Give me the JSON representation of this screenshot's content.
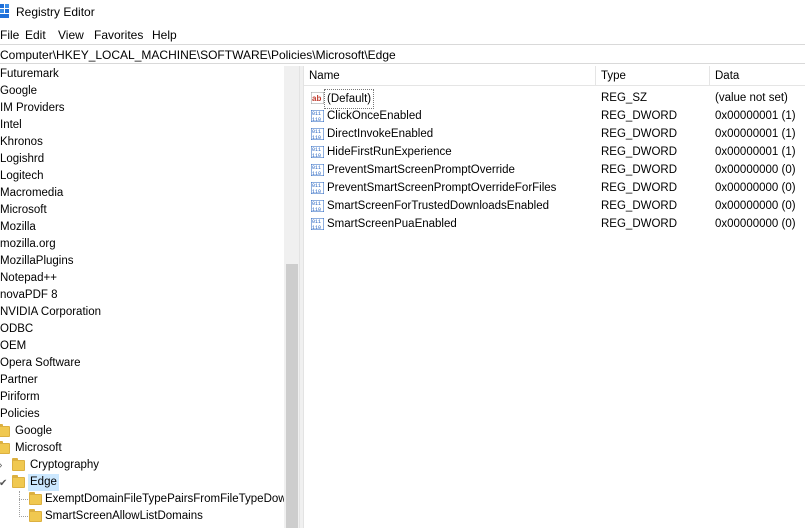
{
  "window": {
    "title": "Registry Editor",
    "icon": "registry-editor-icon"
  },
  "menu": [
    "File",
    "Edit",
    "View",
    "Favorites",
    "Help"
  ],
  "address": "Computer\\HKEY_LOCAL_MACHINE\\SOFTWARE\\Policies\\Microsoft\\Edge",
  "tree": {
    "top_items": [
      "Futuremark",
      "Google",
      "IM Providers",
      "Intel",
      "Khronos",
      "Logishrd",
      "Logitech",
      "Macromedia",
      "Microsoft",
      "Mozilla",
      "mozilla.org",
      "MozillaPlugins",
      "Notepad++",
      "novaPDF 8",
      "NVIDIA Corporation",
      "ODBC",
      "OEM",
      "Opera Software",
      "Partner",
      "Piriform",
      "Policies"
    ],
    "policies_children": [
      "Google",
      "Microsoft"
    ],
    "microsoft_children": [
      "Cryptography",
      "Edge"
    ],
    "edge_children": [
      "ExemptDomainFileTypePairsFromFileTypeDown",
      "SmartScreenAllowListDomains"
    ],
    "selected": "Edge"
  },
  "list": {
    "columns": [
      "Name",
      "Type",
      "Data"
    ],
    "rows": [
      {
        "icon": "string-value-icon",
        "name": "(Default)",
        "type": "REG_SZ",
        "data": "(value not set)"
      },
      {
        "icon": "dword-value-icon",
        "name": "ClickOnceEnabled",
        "type": "REG_DWORD",
        "data": "0x00000001 (1)"
      },
      {
        "icon": "dword-value-icon",
        "name": "DirectInvokeEnabled",
        "type": "REG_DWORD",
        "data": "0x00000001 (1)"
      },
      {
        "icon": "dword-value-icon",
        "name": "HideFirstRunExperience",
        "type": "REG_DWORD",
        "data": "0x00000001 (1)"
      },
      {
        "icon": "dword-value-icon",
        "name": "PreventSmartScreenPromptOverride",
        "type": "REG_DWORD",
        "data": "0x00000000 (0)"
      },
      {
        "icon": "dword-value-icon",
        "name": "PreventSmartScreenPromptOverrideForFiles",
        "type": "REG_DWORD",
        "data": "0x00000000 (0)"
      },
      {
        "icon": "dword-value-icon",
        "name": "SmartScreenForTrustedDownloadsEnabled",
        "type": "REG_DWORD",
        "data": "0x00000000 (0)"
      },
      {
        "icon": "dword-value-icon",
        "name": "SmartScreenPuaEnabled",
        "type": "REG_DWORD",
        "data": "0x00000000 (0)"
      }
    ]
  },
  "colors": {
    "selection": "#cce8ff",
    "folder": "#f0c850",
    "dword_icon": "#1f5fbf",
    "string_icon": "#c0392b"
  }
}
